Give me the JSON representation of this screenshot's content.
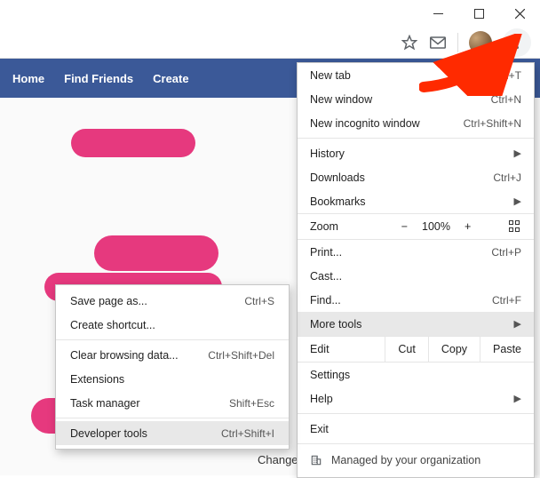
{
  "window": {
    "minimize": "—",
    "maximize": "▢",
    "close": "✕"
  },
  "toolbar": {
    "star": "☆",
    "mail": "✉"
  },
  "fb": {
    "nav": [
      "Home",
      "Find Friends",
      "Create"
    ]
  },
  "menu": {
    "new_tab": {
      "label": "New tab",
      "short": "Ctrl+T"
    },
    "new_window": {
      "label": "New window",
      "short": "Ctrl+N"
    },
    "new_incognito": {
      "label": "New incognito window",
      "short": "Ctrl+Shift+N"
    },
    "history": {
      "label": "History"
    },
    "downloads": {
      "label": "Downloads",
      "short": "Ctrl+J"
    },
    "bookmarks": {
      "label": "Bookmarks"
    },
    "zoom": {
      "label": "Zoom",
      "value": "100%",
      "minus": "−",
      "plus": "+"
    },
    "print": {
      "label": "Print...",
      "short": "Ctrl+P"
    },
    "cast": {
      "label": "Cast..."
    },
    "find": {
      "label": "Find...",
      "short": "Ctrl+F"
    },
    "more_tools": {
      "label": "More tools"
    },
    "edit": {
      "label": "Edit",
      "cut": "Cut",
      "copy": "Copy",
      "paste": "Paste"
    },
    "settings": {
      "label": "Settings"
    },
    "help": {
      "label": "Help"
    },
    "exit": {
      "label": "Exit"
    },
    "managed": {
      "label": "Managed by your organization"
    }
  },
  "submenu": {
    "save_page": {
      "label": "Save page as...",
      "short": "Ctrl+S"
    },
    "create_shortcut": {
      "label": "Create shortcut..."
    },
    "clear_browsing": {
      "label": "Clear browsing data...",
      "short": "Ctrl+Shift+Del"
    },
    "extensions": {
      "label": "Extensions"
    },
    "task_manager": {
      "label": "Task manager",
      "short": "Shift+Esc"
    },
    "developer_tools": {
      "label": "Developer tools",
      "short": "Ctrl+Shift+I"
    }
  },
  "bottom": {
    "change_theme": "Change Theme"
  }
}
